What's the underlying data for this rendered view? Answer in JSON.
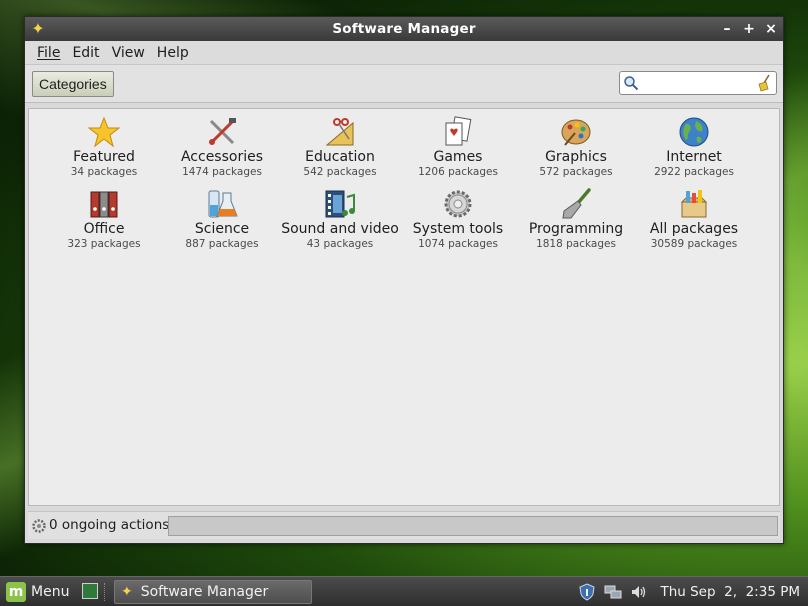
{
  "window": {
    "title": "Software Manager",
    "controls": {
      "minimize": "–",
      "maximize": "+",
      "close": "×"
    }
  },
  "menubar": [
    "File",
    "Edit",
    "View",
    "Help"
  ],
  "toolbar": {
    "categories_label": "Categories",
    "search": {
      "value": "",
      "placeholder": ""
    }
  },
  "categories": [
    {
      "name": "Featured",
      "count": "34 packages",
      "icon": "star-icon"
    },
    {
      "name": "Accessories",
      "count": "1474 packages",
      "icon": "tools-icon"
    },
    {
      "name": "Education",
      "count": "542 packages",
      "icon": "ruler-icon"
    },
    {
      "name": "Games",
      "count": "1206 packages",
      "icon": "cards-icon"
    },
    {
      "name": "Graphics",
      "count": "572 packages",
      "icon": "palette-icon"
    },
    {
      "name": "Internet",
      "count": "2922 packages",
      "icon": "globe-icon"
    },
    {
      "name": "Office",
      "count": "323 packages",
      "icon": "binders-icon"
    },
    {
      "name": "Science",
      "count": "887 packages",
      "icon": "flask-icon"
    },
    {
      "name": "Sound and video",
      "count": "43 packages",
      "icon": "media-icon"
    },
    {
      "name": "System tools",
      "count": "1074 packages",
      "icon": "gear-icon"
    },
    {
      "name": "Programming",
      "count": "1818 packages",
      "icon": "trowel-icon"
    },
    {
      "name": "All packages",
      "count": "30589 packages",
      "icon": "box-icon"
    }
  ],
  "status": {
    "text": "0 ongoing actions",
    "progress": 0
  },
  "taskbar": {
    "menu_label": "Menu",
    "task_label": "Software Manager",
    "clock": "Thu Sep  2,  2:35 PM"
  },
  "colors": {
    "accent": "#8bc34a",
    "star": "#f3d34a"
  }
}
